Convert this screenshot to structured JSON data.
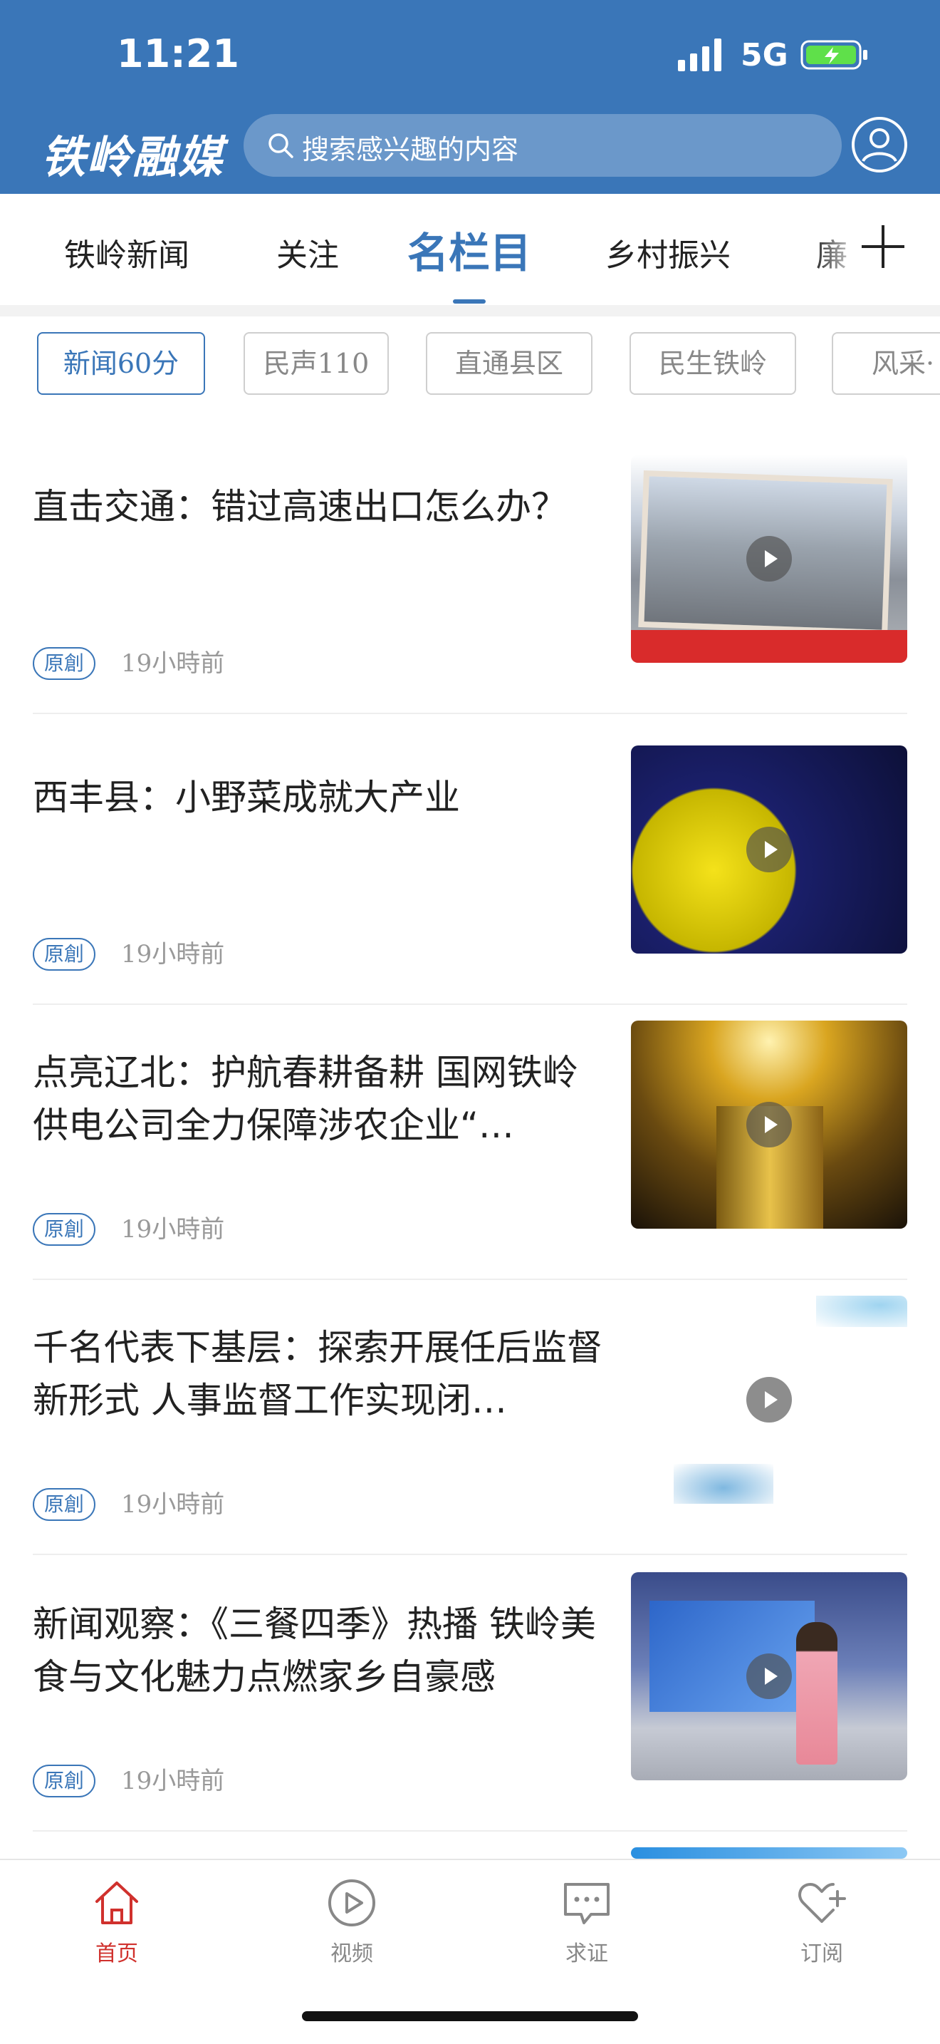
{
  "status_bar": {
    "time": "11:21",
    "network": "5G"
  },
  "header": {
    "logo_text": "铁岭融媒",
    "search_placeholder": "搜索感兴趣的内容"
  },
  "channels": [
    {
      "label": "铁岭新闻"
    },
    {
      "label": "关注"
    },
    {
      "label": "名栏目",
      "active": true
    },
    {
      "label": "乡村振兴"
    },
    {
      "label": "廉"
    }
  ],
  "subtabs": [
    {
      "label": "新闻60分",
      "active": true
    },
    {
      "label": "民声110"
    },
    {
      "label": "直通县区"
    },
    {
      "label": "民生铁岭"
    },
    {
      "label": "风采·"
    }
  ],
  "news": [
    {
      "title": "直击交通：错过高速出口怎么办？",
      "badge": "原創",
      "time": "19小時前"
    },
    {
      "title": "西丰县：小野菜成就大产业",
      "badge": "原創",
      "time": "19小時前"
    },
    {
      "title": "点亮辽北：护航春耕备耕 国网铁岭供电公司全力保障涉农企业“…",
      "badge": "原創",
      "time": "19小時前"
    },
    {
      "title": "千名代表下基层：探索开展任后监督新形式 人事监督工作实现闭…",
      "badge": "原創",
      "time": "19小時前"
    },
    {
      "title": "新闻观察：《三餐四季》热播 铁岭美食与文化魅力点燃家乡自豪感",
      "badge": "原創",
      "time": "19小時前"
    }
  ],
  "tabbar": [
    {
      "label": "首页",
      "icon": "home-icon",
      "active": true
    },
    {
      "label": "视频",
      "icon": "video-icon"
    },
    {
      "label": "求证",
      "icon": "chat-icon"
    },
    {
      "label": "订阅",
      "icon": "heart-plus-icon"
    }
  ],
  "colors": {
    "brand": "#3a76b8",
    "active_tab": "#d0312d",
    "text": "#222222",
    "muted": "#999999"
  }
}
